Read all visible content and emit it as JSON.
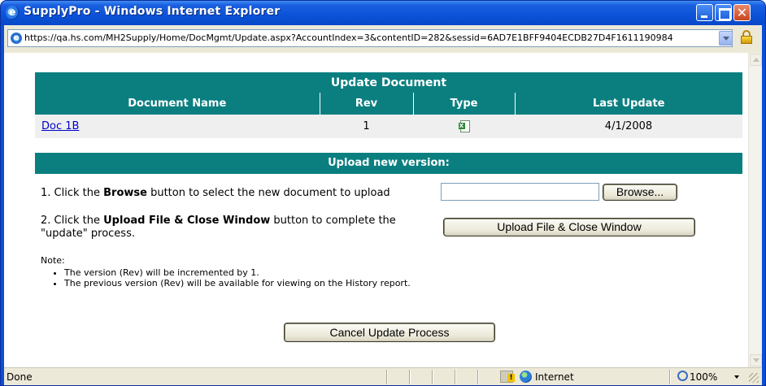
{
  "window": {
    "title": "SupplyPro - Windows Internet Explorer",
    "address": "https://qa.hs.com/MH2Supply/Home/DocMgmt/Update.aspx?AccountIndex=3&contentID=282&sessid=6AD7E1BFF9404ECDB27D4F1611190984"
  },
  "update_document": {
    "heading": "Update Document",
    "columns": [
      "Document Name",
      "Rev",
      "Type",
      "Last Update"
    ],
    "row": {
      "name": "Doc 1B",
      "rev": "1",
      "type_icon": "excel-file-icon",
      "last_update": "4/1/2008"
    }
  },
  "upload": {
    "heading": "Upload new version:",
    "step1_prefix": "1. Click the ",
    "step1_bold": "Browse",
    "step1_suffix": " button to select the new document to upload",
    "step2_prefix": "2. Click the ",
    "step2_bold": "Upload File & Close Window",
    "step2_suffix": " button to complete the \"update\" process.",
    "file_value": "",
    "browse_label": "Browse...",
    "upload_label": "Upload File & Close Window"
  },
  "note": {
    "label": "Note:",
    "items": [
      "The version (Rev) will be incremented by 1.",
      "The previous version (Rev) will be available for viewing on the History report."
    ]
  },
  "cancel_label": "Cancel Update Process",
  "status": {
    "text": "Done",
    "zone": "Internet",
    "zoom": "100%"
  },
  "colors": {
    "teal": "#0b7f80",
    "titlebar": "#0a52d8",
    "link": "#0000cc"
  }
}
